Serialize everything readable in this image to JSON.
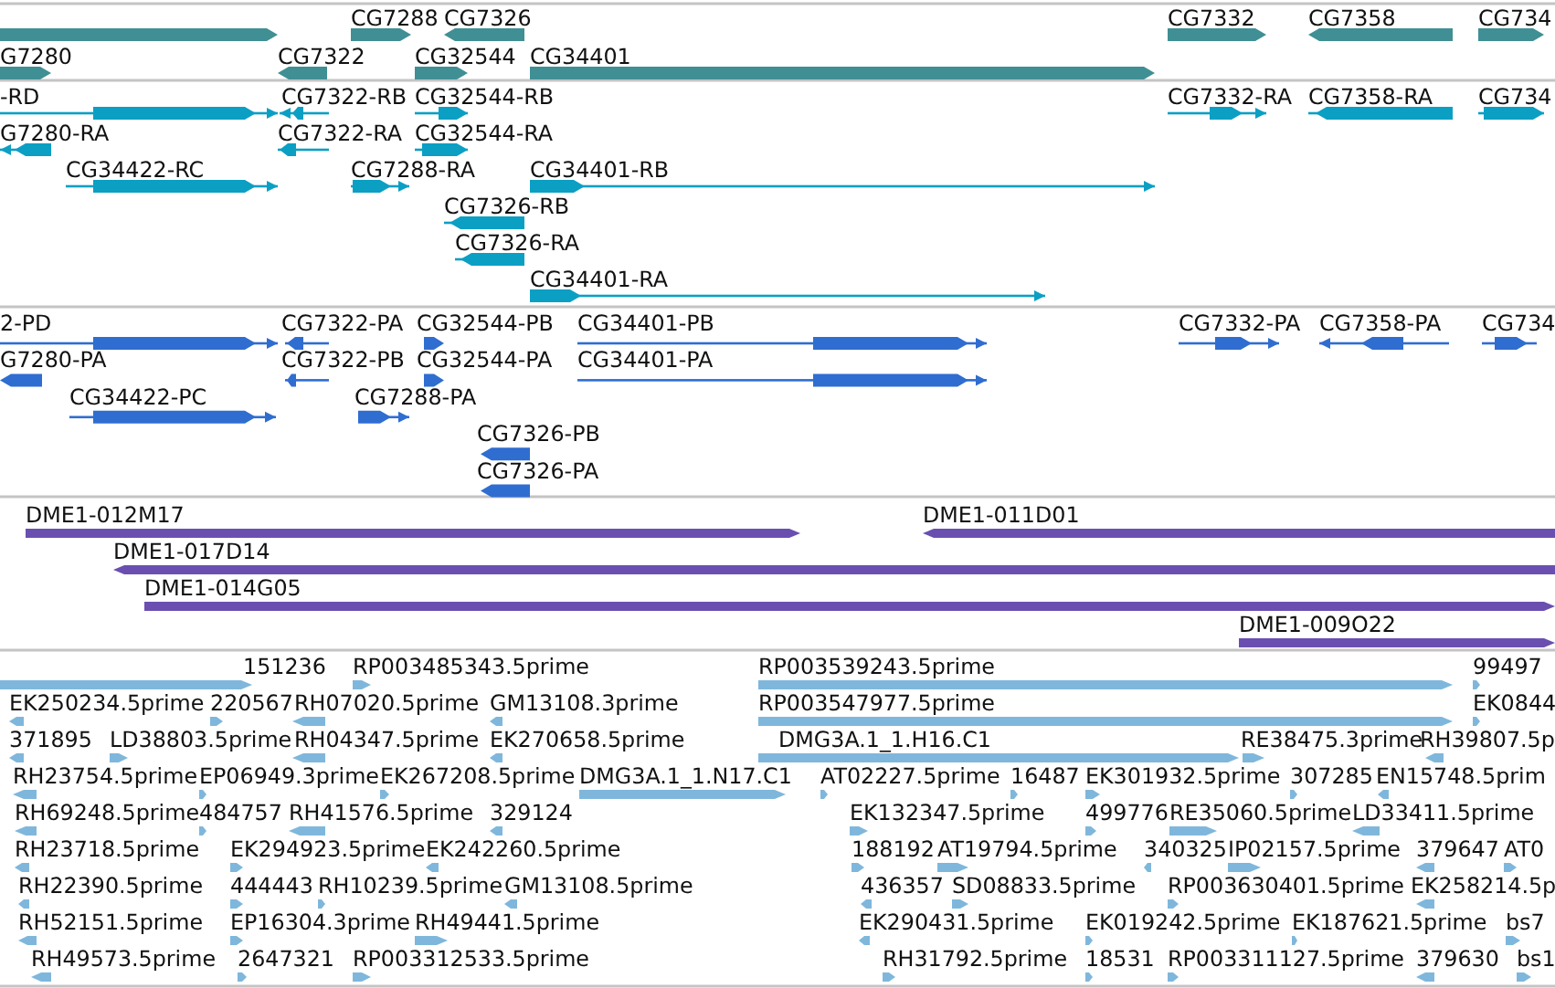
{
  "tracks": [
    {
      "color": "#3f8f94",
      "features": [
        {
          "reverse": false
        },
        {
          "label": "CG7288",
          "reverse": false
        },
        {
          "label": "CG7326",
          "reverse": true
        },
        {
          "label": "G7280",
          "reverse": false
        },
        {
          "label": "CG7322",
          "reverse": true
        },
        {
          "label": "CG32544",
          "reverse": false
        },
        {
          "label": "CG34401",
          "reverse": false
        },
        {
          "label": "CG7332",
          "reverse": false
        },
        {
          "label": "CG7358",
          "reverse": true
        },
        {
          "label": "CG734",
          "reverse": false
        }
      ]
    },
    {
      "color": "#0c9fc4",
      "features": [
        {
          "label": "-RD",
          "reverse": false
        },
        {
          "label": "CG7322-RB",
          "reverse": true
        },
        {
          "label": "CG32544-RB",
          "reverse": false
        },
        {
          "label": "CG7332-RA",
          "reverse": false
        },
        {
          "label": "CG7358-RA",
          "reverse": true
        },
        {
          "label": "CG734",
          "reverse": false
        },
        {
          "label": "G7280-RA",
          "reverse": true
        },
        {
          "label": "CG7322-RA",
          "reverse": true
        },
        {
          "label": "CG32544-RA",
          "reverse": false
        },
        {
          "label": "CG34422-RC",
          "reverse": false
        },
        {
          "label": "CG7288-RA",
          "reverse": false
        },
        {
          "label": "CG34401-RB",
          "reverse": false
        },
        {
          "label": "CG7326-RB",
          "reverse": true
        },
        {
          "label": "CG7326-RA",
          "reverse": true
        },
        {
          "label": "CG34401-RA",
          "reverse": false
        }
      ]
    },
    {
      "color": "#2f6dd0",
      "features": [
        {
          "label": "2-PD",
          "reverse": false
        },
        {
          "label": "CG7322-PA",
          "reverse": true
        },
        {
          "label": "CG32544-PB",
          "reverse": false
        },
        {
          "label": "CG34401-PB",
          "reverse": false
        },
        {
          "label": "CG7332-PA",
          "reverse": false
        },
        {
          "label": "CG7358-PA",
          "reverse": true
        },
        {
          "label": "CG734",
          "reverse": false
        },
        {
          "label": "G7280-PA",
          "reverse": true
        },
        {
          "label": "CG7322-PB",
          "reverse": true
        },
        {
          "label": "CG32544-PA",
          "reverse": false
        },
        {
          "label": "CG34401-PA",
          "reverse": false
        },
        {
          "label": "CG34422-PC",
          "reverse": false
        },
        {
          "label": "CG7288-PA",
          "reverse": false
        },
        {
          "label": "CG7326-PB",
          "reverse": true
        },
        {
          "label": "CG7326-PA",
          "reverse": true
        }
      ]
    },
    {
      "color": "#6a4fb0",
      "features": [
        {
          "label": "DME1-012M17",
          "reverse": false
        },
        {
          "label": "DME1-011D01",
          "reverse": true
        },
        {
          "label": "DME1-017D14",
          "reverse": true
        },
        {
          "label": "DME1-014G05",
          "reverse": false
        },
        {
          "label": "DME1-009O22",
          "reverse": false
        }
      ]
    },
    {
      "color": "#7fb7dc",
      "features": [
        {
          "label": "151236",
          "reverse": false
        },
        {
          "label": "RP003485343.5prime",
          "reverse": false
        },
        {
          "label": "RP003539243.5prime",
          "reverse": false
        },
        {
          "label": "99497",
          "reverse": false
        },
        {
          "label": "EK250234.5prime",
          "reverse": true
        },
        {
          "label": "220567",
          "reverse": false
        },
        {
          "label": "RH07020.5prime",
          "reverse": true
        },
        {
          "label": "GM13108.3prime",
          "reverse": true
        },
        {
          "label": "RP003547977.5prime",
          "reverse": false
        },
        {
          "label": "EK0844",
          "reverse": false
        },
        {
          "label": "371895",
          "reverse": true
        },
        {
          "label": "LD38803.5prime",
          "reverse": false
        },
        {
          "label": "RH04347.5prime",
          "reverse": true
        },
        {
          "label": "EK270658.5prime",
          "reverse": true
        },
        {
          "label": "DMG3A.1_1.H16.C1",
          "reverse": false
        },
        {
          "label": "RE38475.3prime",
          "reverse": false
        },
        {
          "label": "RH39807.5p",
          "reverse": true
        },
        {
          "label": "RH23754.5prime",
          "reverse": true
        },
        {
          "label": "EP06949.3prime",
          "reverse": false
        },
        {
          "label": "EK267208.5prime",
          "reverse": false
        },
        {
          "label": "DMG3A.1_1.N17.C1",
          "reverse": false
        },
        {
          "label": "AT02227.5prime",
          "reverse": false
        },
        {
          "label": "16487",
          "reverse": false
        },
        {
          "label": "EK301932.5prime",
          "reverse": false
        },
        {
          "label": "307285",
          "reverse": false
        },
        {
          "label": "EN15748.5prim",
          "reverse": true
        },
        {
          "label": "RH69248.5prime",
          "reverse": true
        },
        {
          "label": "484757",
          "reverse": false
        },
        {
          "label": "RH41576.5prime",
          "reverse": true
        },
        {
          "label": "329124",
          "reverse": true
        },
        {
          "label": "EK132347.5prime",
          "reverse": false
        },
        {
          "label": "499776",
          "reverse": false
        },
        {
          "label": "RE35060.5prime",
          "reverse": false
        },
        {
          "label": "LD33411.5prime",
          "reverse": true
        },
        {
          "label": "RH23718.5prime",
          "reverse": true
        },
        {
          "label": "EK294923.5prime",
          "reverse": false
        },
        {
          "label": "EK242260.5prime",
          "reverse": true
        },
        {
          "label": "188192",
          "reverse": false
        },
        {
          "label": "AT19794.5prime",
          "reverse": false
        },
        {
          "label": "340325",
          "reverse": true
        },
        {
          "label": "IP02157.5prime",
          "reverse": false
        },
        {
          "label": "379647",
          "reverse": true
        },
        {
          "label": "AT0",
          "reverse": false
        },
        {
          "label": "RH22390.5prime",
          "reverse": true
        },
        {
          "label": "444443",
          "reverse": false
        },
        {
          "label": "RH10239.5prime",
          "reverse": false
        },
        {
          "label": "GM13108.5prime",
          "reverse": true
        },
        {
          "label": "436357",
          "reverse": true
        },
        {
          "label": "SD08833.5prime",
          "reverse": false
        },
        {
          "label": "RP003630401.5prime",
          "reverse": false
        },
        {
          "label": "EK258214.5p",
          "reverse": true
        },
        {
          "label": "RH52151.5prime",
          "reverse": true
        },
        {
          "label": "EP16304.3prime",
          "reverse": false
        },
        {
          "label": "RH49441.5prime",
          "reverse": false
        },
        {
          "label": "EK290431.5prime",
          "reverse": true
        },
        {
          "label": "EK019242.5prime",
          "reverse": false
        },
        {
          "label": "EK187621.5prime",
          "reverse": false
        },
        {
          "label": "bs7",
          "reverse": false
        },
        {
          "label": "RH49573.5prime",
          "reverse": true
        },
        {
          "label": "2647321",
          "reverse": false
        },
        {
          "label": "RP003312533.5prime",
          "reverse": false
        },
        {
          "label": "RH31792.5prime",
          "reverse": false
        },
        {
          "label": "18531",
          "reverse": false
        },
        {
          "label": "RP003311127.5prime",
          "reverse": false
        },
        {
          "label": "379630",
          "reverse": true
        },
        {
          "label": "bs1",
          "reverse": false
        }
      ]
    }
  ]
}
